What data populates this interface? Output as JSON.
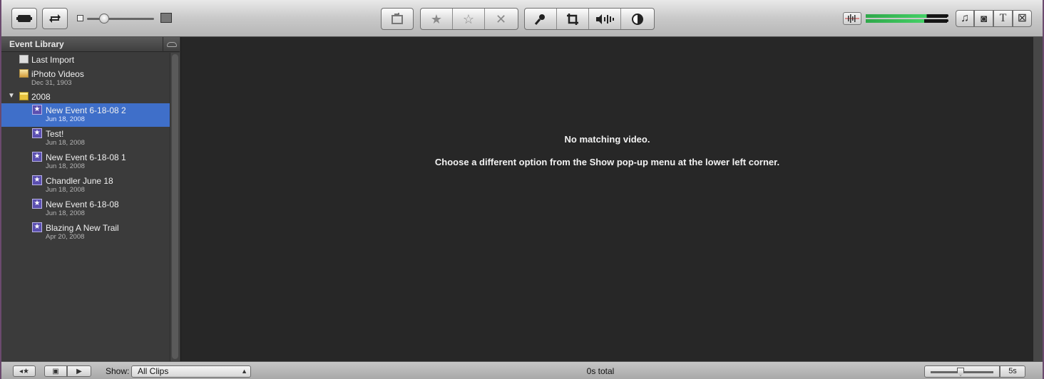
{
  "toolbar": {
    "left_buttons": [
      {
        "icon": "camera-import-icon"
      },
      {
        "icon": "swap-icon"
      }
    ],
    "thumbnail_zoom_level": 0.25,
    "edit_group": [
      {
        "icon": "add-to-project-icon"
      }
    ],
    "rating_group": [
      {
        "icon": "favorite-star-icon"
      },
      {
        "icon": "unmark-star-icon"
      },
      {
        "icon": "reject-x-icon"
      }
    ],
    "tools_group": [
      {
        "icon": "voiceover-mic-icon"
      },
      {
        "icon": "crop-icon"
      },
      {
        "icon": "audio-adjust-icon"
      },
      {
        "icon": "video-adjust-icon"
      }
    ],
    "browser_buttons": [
      {
        "icon": "music-note-icon",
        "glyph": "♫"
      },
      {
        "icon": "photo-camera-icon",
        "glyph": "◙"
      },
      {
        "icon": "title-icon",
        "glyph": "T"
      },
      {
        "icon": "transitions-icon",
        "glyph": "⊠"
      }
    ],
    "audio_levels": [
      0.75,
      0.72
    ]
  },
  "sidebar": {
    "title": "Event Library",
    "items": [
      {
        "label": "Last Import",
        "sub": "",
        "icon": "last-import-icon",
        "indent": 1
      },
      {
        "label": "iPhoto Videos",
        "sub": "Dec 31, 1903",
        "icon": "iphoto-icon",
        "indent": 1
      },
      {
        "label": "2008",
        "sub": "",
        "icon": "calendar-year-icon",
        "indent": 1,
        "expanded": true
      },
      {
        "label": "New Event 6-18-08 2",
        "sub": "Jun 18, 2008",
        "icon": "event-star-icon",
        "indent": 2,
        "selected": true
      },
      {
        "label": "Test!",
        "sub": "Jun 18, 2008",
        "icon": "event-star-icon",
        "indent": 2
      },
      {
        "label": "New Event 6-18-08 1",
        "sub": "Jun 18, 2008",
        "icon": "event-star-icon",
        "indent": 2
      },
      {
        "label": "Chandler June 18",
        "sub": "Jun 18, 2008",
        "icon": "event-star-icon",
        "indent": 2
      },
      {
        "label": "New Event 6-18-08",
        "sub": "Jun 18, 2008",
        "icon": "event-star-icon",
        "indent": 2
      },
      {
        "label": "Blazing A New Trail",
        "sub": "Apr 20, 2008",
        "icon": "event-star-icon",
        "indent": 2
      }
    ]
  },
  "viewer": {
    "message_title": "No matching video.",
    "message_body": "Choose a different option from the Show pop-up menu at the lower left corner."
  },
  "bottombar": {
    "show_label": "Show:",
    "show_value": "All Clips",
    "total": "0s total",
    "duration_value": "5s"
  },
  "colors": {
    "selection": "#3f6fc9",
    "meter_green": "#44d066",
    "event_icon": "#5b4fb0"
  }
}
